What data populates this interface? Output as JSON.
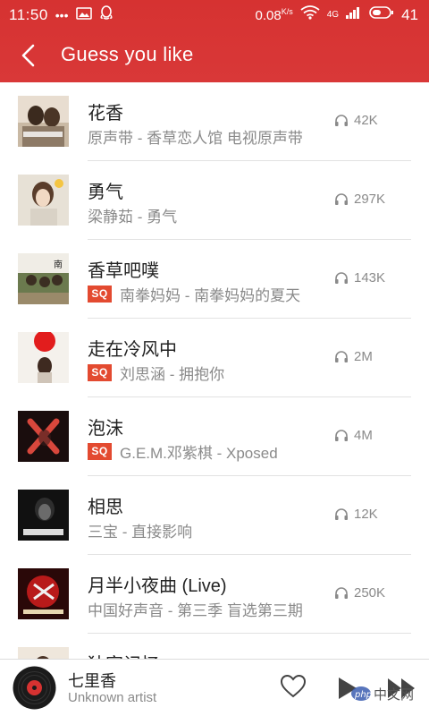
{
  "status_bar": {
    "time": "11:50",
    "dots": "•••",
    "speed": "0.08",
    "speed_unit": "K/s",
    "network": "4G",
    "battery": "41"
  },
  "header": {
    "title": "Guess you like"
  },
  "colors": {
    "accent": "#d63231",
    "sq_badge": "#e34a30"
  },
  "sq_badge_label": "SQ",
  "songs": [
    {
      "title": "花香",
      "sq": false,
      "subtitle": "原声带 - 香草恋人馆 电视原声带",
      "plays": "42K"
    },
    {
      "title": "勇气",
      "sq": false,
      "subtitle": "梁静茹 - 勇气",
      "plays": "297K"
    },
    {
      "title": "香草吧噗",
      "sq": true,
      "subtitle": "南拳妈妈 - 南拳妈妈的夏天",
      "plays": "143K"
    },
    {
      "title": "走在冷风中",
      "sq": true,
      "subtitle": "刘思涵 - 拥抱你",
      "plays": "2M"
    },
    {
      "title": "泡沫",
      "sq": true,
      "subtitle": "G.E.M.邓紫棋 - Xposed",
      "plays": "4M"
    },
    {
      "title": "相思",
      "sq": false,
      "subtitle": "三宝 - 直接影响",
      "plays": "12K"
    },
    {
      "title": "月半小夜曲 (Live)",
      "sq": false,
      "subtitle": "中国好声音 - 第三季 盲选第三期",
      "plays": "250K"
    },
    {
      "title": "独家记忆",
      "sq": false,
      "subtitle": "",
      "plays": ""
    }
  ],
  "player": {
    "title": "七里香",
    "artist": "Unknown artist"
  },
  "watermark": "php中文网"
}
